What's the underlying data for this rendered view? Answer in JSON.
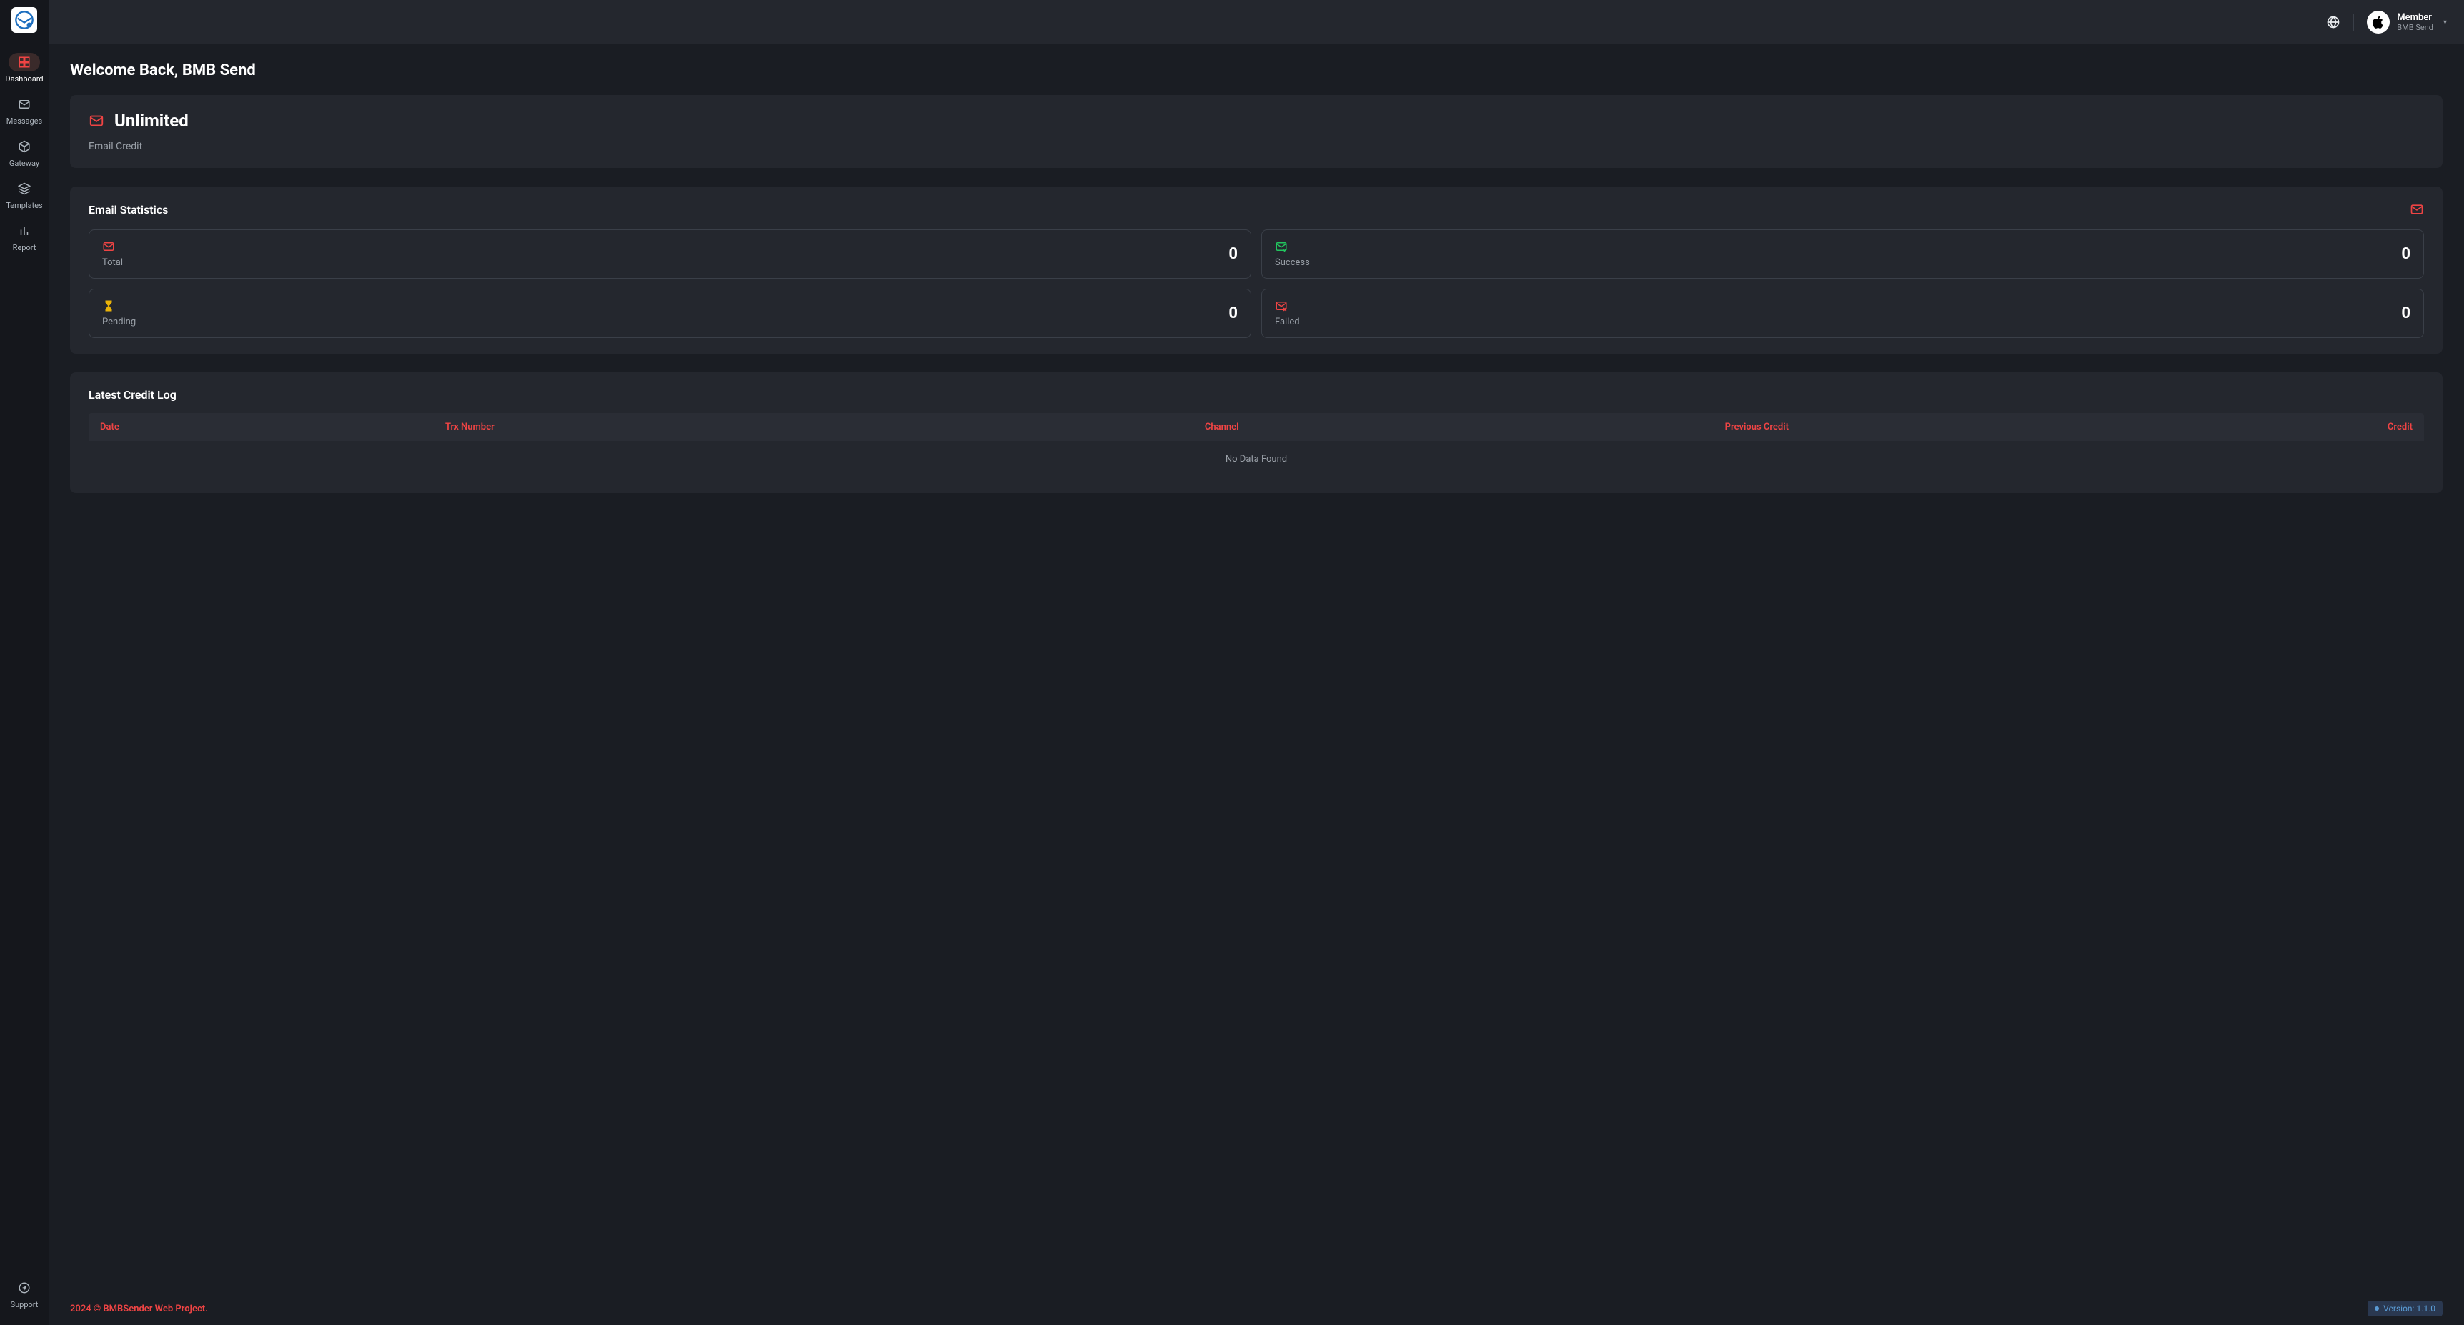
{
  "sidebar": {
    "items": [
      {
        "label": "Dashboard",
        "icon": "grid-icon"
      },
      {
        "label": "Messages",
        "icon": "mail-icon"
      },
      {
        "label": "Gateway",
        "icon": "cube-icon"
      },
      {
        "label": "Templates",
        "icon": "layers-icon"
      },
      {
        "label": "Report",
        "icon": "bar-chart-icon"
      }
    ],
    "support": {
      "label": "Support",
      "icon": "send-icon"
    }
  },
  "topbar": {
    "user_role": "Member",
    "user_name": "BMB Send"
  },
  "page": {
    "title": "Welcome Back, BMB Send"
  },
  "credit": {
    "amount": "Unlimited",
    "label": "Email Credit"
  },
  "stats": {
    "title": "Email Statistics",
    "boxes": [
      {
        "label": "Total",
        "value": "0",
        "icon": "mail-icon",
        "color": "#ef4444"
      },
      {
        "label": "Success",
        "value": "0",
        "icon": "mail-check-icon",
        "color": "#22c55e"
      },
      {
        "label": "Pending",
        "value": "0",
        "icon": "hourglass-icon",
        "color": "#eab308"
      },
      {
        "label": "Failed",
        "value": "0",
        "icon": "mail-x-icon",
        "color": "#ef4444"
      }
    ]
  },
  "log": {
    "title": "Latest Credit Log",
    "columns": [
      "Date",
      "Trx Number",
      "Channel",
      "Previous Credit",
      "Credit"
    ],
    "empty": "No Data Found"
  },
  "footer": {
    "copyright": "2024 © BMBSender Web Project.",
    "version": "Version: 1.1.0"
  }
}
